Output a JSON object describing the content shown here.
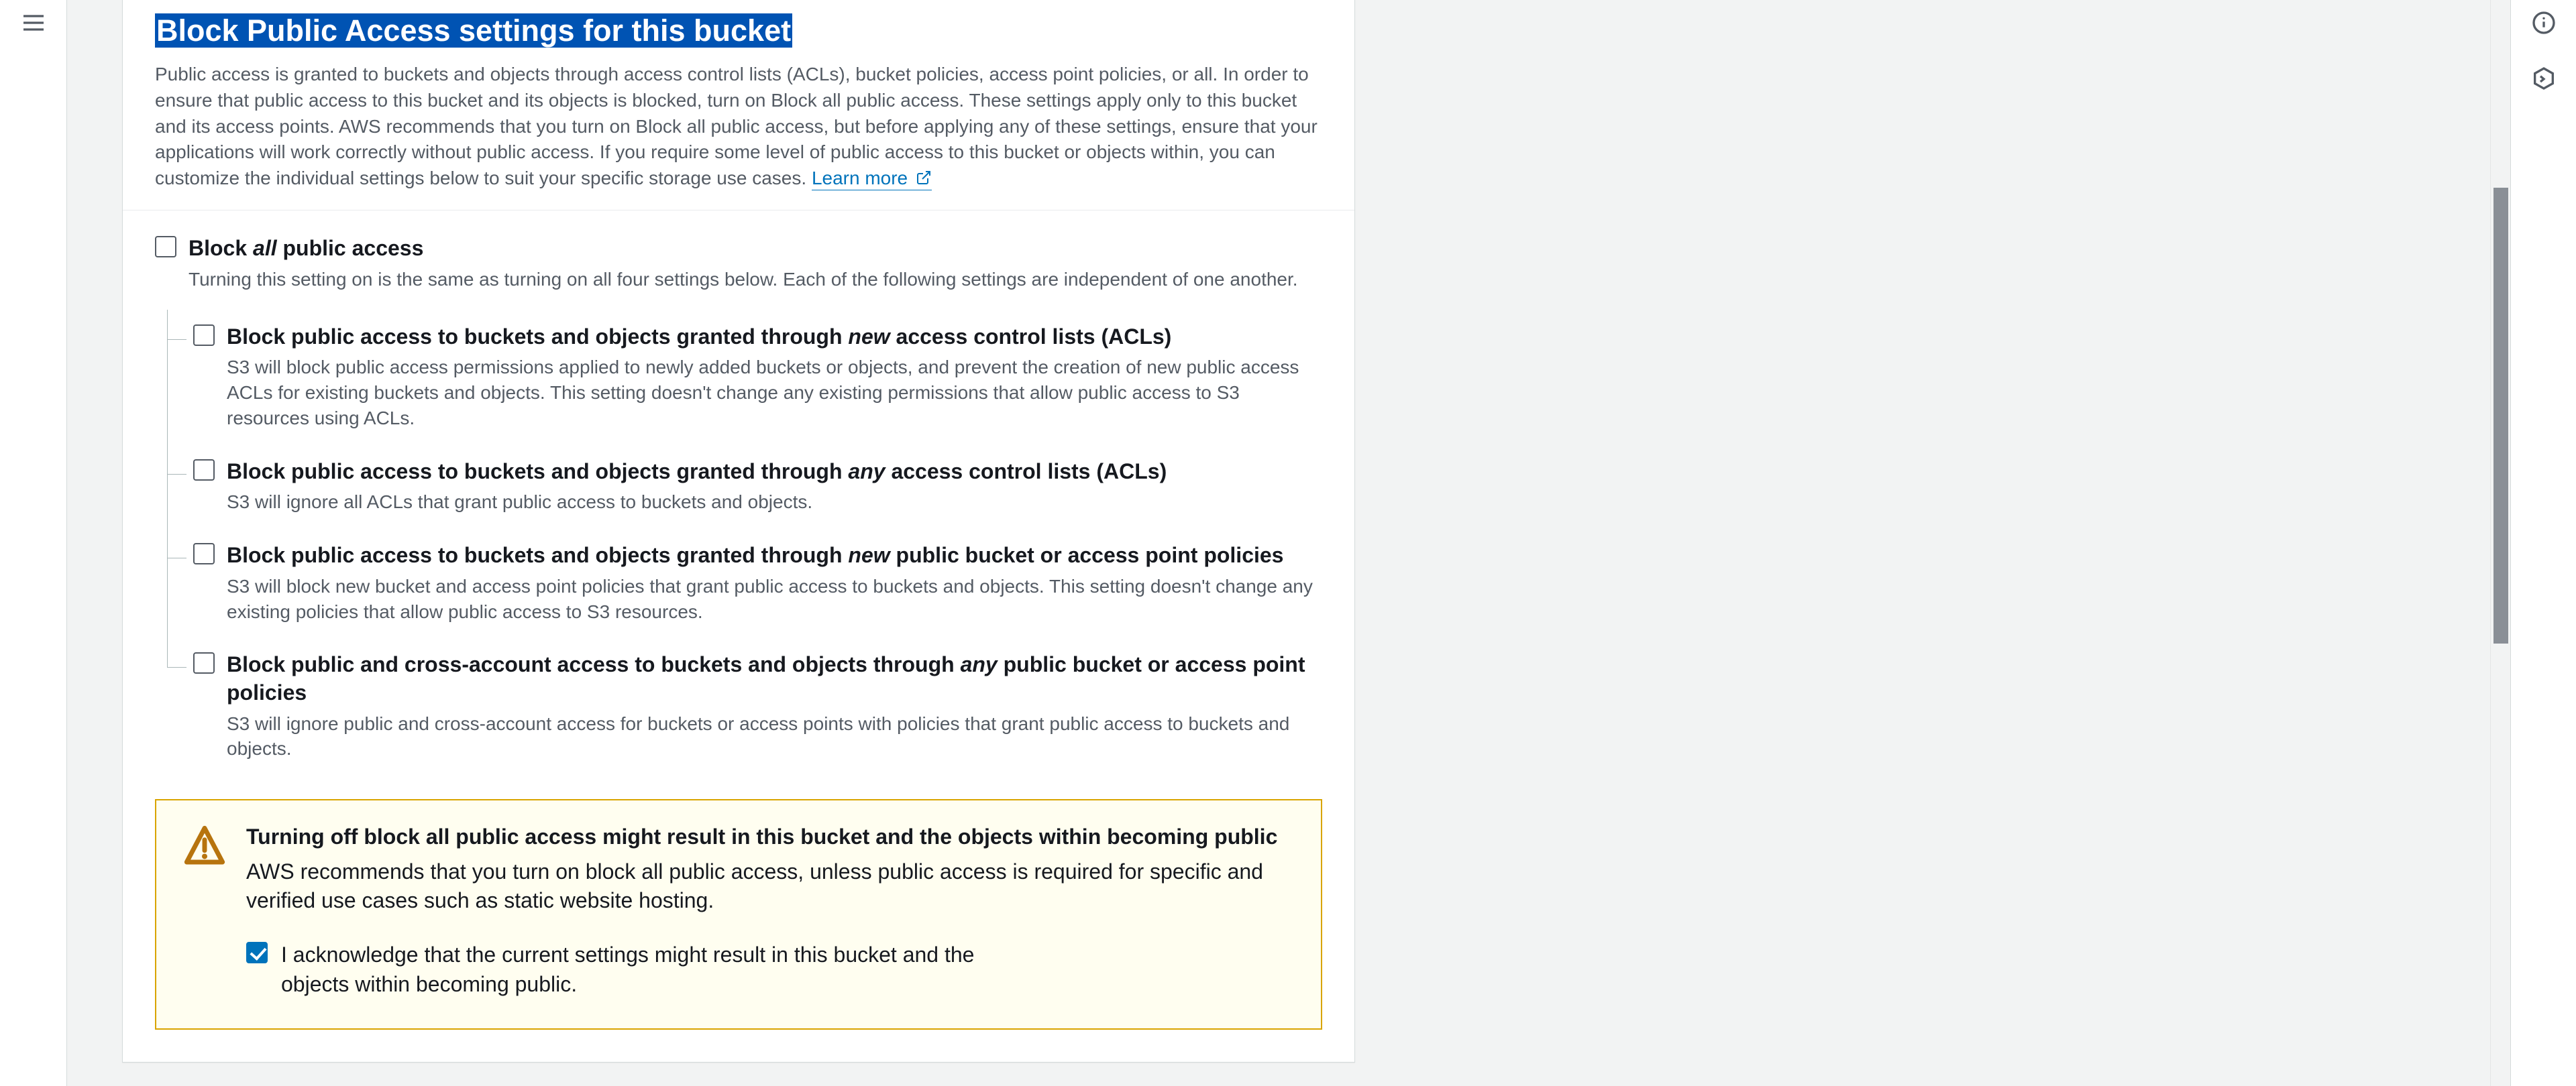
{
  "section": {
    "title": "Block Public Access settings for this bucket",
    "description": "Public access is granted to buckets and objects through access control lists (ACLs), bucket policies, access point policies, or all. In order to ensure that public access to this bucket and its objects is blocked, turn on Block all public access. These settings apply only to this bucket and its access points. AWS recommends that you turn on Block all public access, but before applying any of these settings, ensure that your applications will work correctly without public access. If you require some level of public access to this bucket or objects within, you can customize the individual settings below to suit your specific storage use cases. ",
    "learn_more": "Learn more"
  },
  "block_all": {
    "label_pre": "Block ",
    "label_em": "all",
    "label_post": " public access",
    "hint": "Turning this setting on is the same as turning on all four settings below. Each of the following settings are independent of one another.",
    "checked": false
  },
  "children": [
    {
      "label_pre": "Block public access to buckets and objects granted through ",
      "label_em": "new",
      "label_post": " access control lists (ACLs)",
      "hint": "S3 will block public access permissions applied to newly added buckets or objects, and prevent the creation of new public access ACLs for existing buckets and objects. This setting doesn't change any existing permissions that allow public access to S3 resources using ACLs.",
      "checked": false
    },
    {
      "label_pre": "Block public access to buckets and objects granted through ",
      "label_em": "any",
      "label_post": " access control lists (ACLs)",
      "hint": "S3 will ignore all ACLs that grant public access to buckets and objects.",
      "checked": false
    },
    {
      "label_pre": "Block public access to buckets and objects granted through ",
      "label_em": "new",
      "label_post": " public bucket or access point policies",
      "hint": "S3 will block new bucket and access point policies that grant public access to buckets and objects. This setting doesn't change any existing policies that allow public access to S3 resources.",
      "checked": false
    },
    {
      "label_pre": "Block public and cross-account access to buckets and objects through ",
      "label_em": "any",
      "label_post": " public bucket or access point policies",
      "hint": "S3 will ignore public and cross-account access for buckets or access points with policies that grant public access to buckets and objects.",
      "checked": false
    }
  ],
  "alert": {
    "title": "Turning off block all public access might result in this bucket and the objects within becoming public",
    "text": "AWS recommends that you turn on block all public access, unless public access is required for specific and verified use cases such as static website hosting.",
    "ack_label": "I acknowledge that the current settings might result in this bucket and the objects within becoming public.",
    "ack_checked": true
  }
}
